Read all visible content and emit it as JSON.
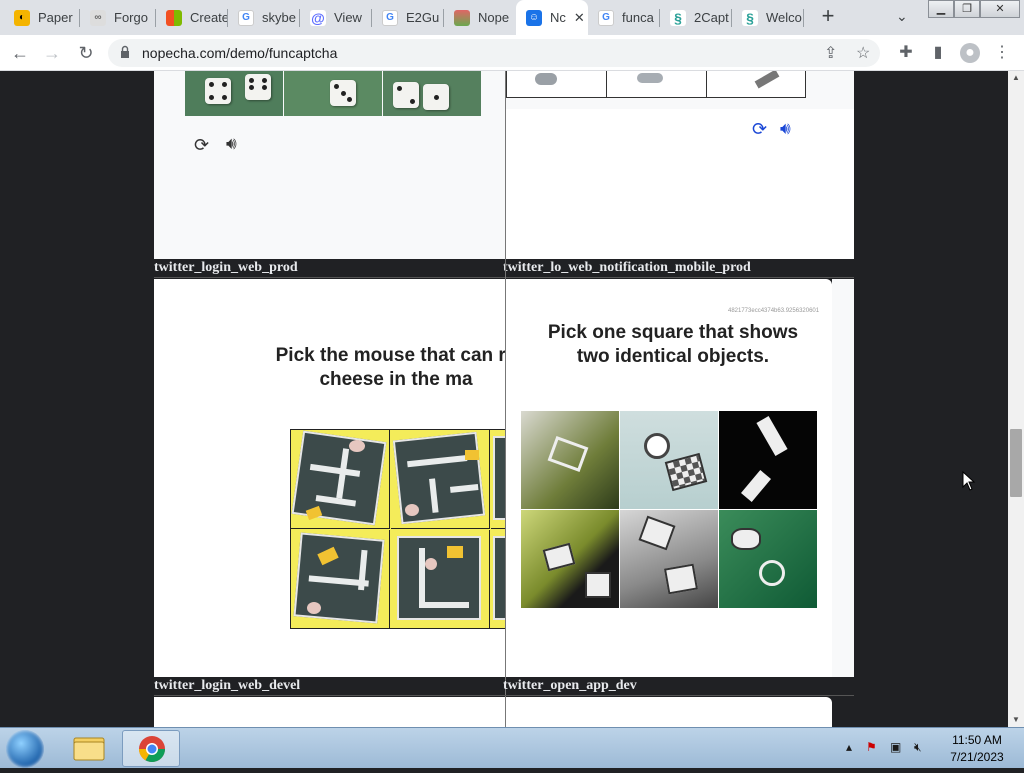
{
  "browser": {
    "tabs": [
      {
        "label": "Paper",
        "icon": "paper-favicon",
        "color": "#f4b400"
      },
      {
        "label": "Forgo",
        "icon": "infinity-favicon",
        "color": "#8a8a8a"
      },
      {
        "label": "Create",
        "icon": "microsoft-favicon",
        "color": "#f25022"
      },
      {
        "label": "skybe",
        "icon": "google-favicon",
        "color": "#4285f4"
      },
      {
        "label": "View",
        "icon": "at-favicon",
        "color": "#5b6cff"
      },
      {
        "label": "E2Gu",
        "icon": "google-favicon",
        "color": "#4285f4"
      },
      {
        "label": "Nope",
        "icon": "nopecha-favicon",
        "color": "#e06666"
      },
      {
        "label": "Nc",
        "icon": "robot-favicon",
        "color": "#1a73e8"
      },
      {
        "label": "funca",
        "icon": "google-favicon",
        "color": "#4285f4"
      },
      {
        "label": "2Capt",
        "icon": "2captcha-favicon",
        "color": "#2aa198"
      },
      {
        "label": "Welco",
        "icon": "welcome-favicon",
        "color": "#2aa198"
      }
    ],
    "active_tab_index": 7,
    "new_tab_glyph": "+",
    "url": "nopecha.com/demo/funcaptcha"
  },
  "page": {
    "labels": {
      "top_left": "twitter_login_web_prod",
      "top_right": "twitter_lo_web_notification_mobile_prod",
      "mid_left": "twitter_login_web_devel",
      "mid_right": "twitter_open_app_dev"
    },
    "captchas": {
      "mouse": {
        "title_line1": "Pick the mouse that can re",
        "title_line2": "cheese in the ma"
      },
      "identical": {
        "hash": "4821773ecc4374b63.9256320601",
        "title_line1": "Pick one square that shows",
        "title_line2": "two identical objects."
      }
    }
  },
  "taskbar": {
    "time": "11:50 AM",
    "date": "7/21/2023"
  },
  "colors": {
    "page_bg": "#202124",
    "accent_blue": "#1a47d6",
    "maze_yellow": "#f4ec5a"
  }
}
